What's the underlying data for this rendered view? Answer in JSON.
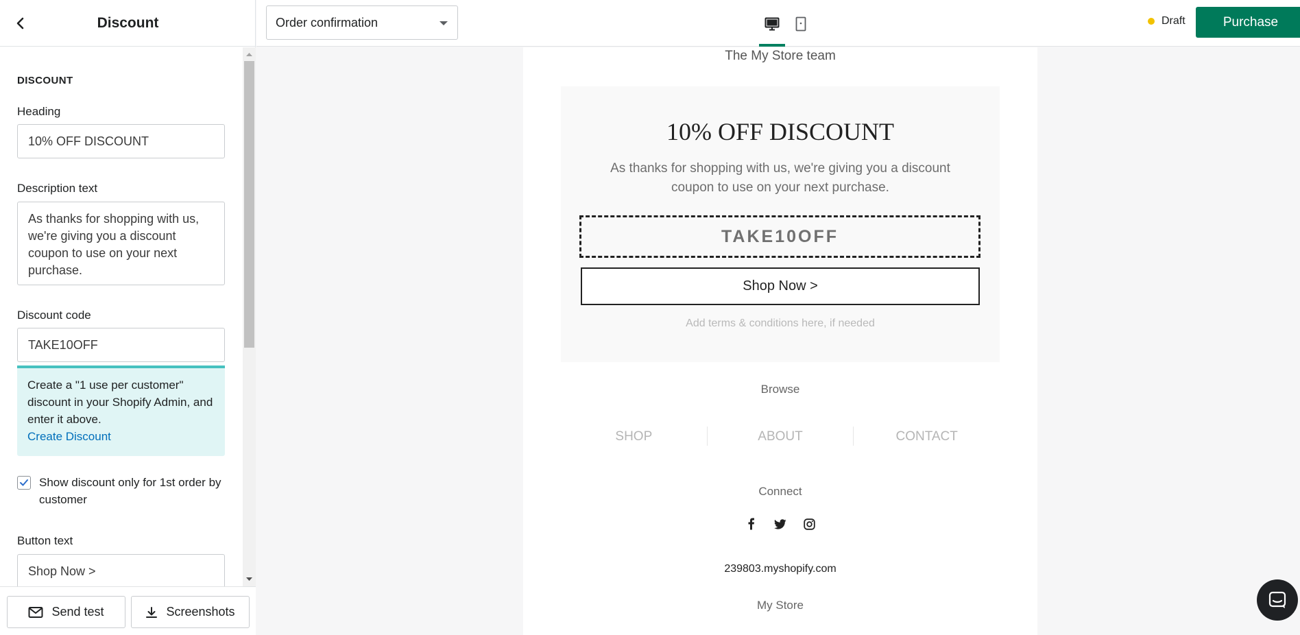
{
  "panel": {
    "title": "Discount",
    "section_title": "DISCOUNT",
    "heading_label": "Heading",
    "heading_value": "10% OFF DISCOUNT",
    "description_label": "Description text",
    "description_value": "As thanks for shopping with us, we're giving you a discount coupon to use on your next purchase.",
    "code_label": "Discount code",
    "code_value": "TAKE10OFF",
    "info_text": "Create a \"1 use per customer\" discount in your Shopify Admin, and enter it above.",
    "info_link": "Create Discount",
    "checkbox_label": "Show discount only for 1st order by customer",
    "checkbox_checked": true,
    "button_text_label": "Button text",
    "button_text_value": "Shop Now >",
    "send_test": "Send test",
    "screenshots": "Screenshots"
  },
  "topbar": {
    "template": "Order confirmation",
    "status": "Draft",
    "purchase": "Purchase",
    "accent_color": "#007a5a",
    "status_color": "#f2c200"
  },
  "email": {
    "team_line": "The My Store team",
    "discount_heading": "10% OFF DISCOUNT",
    "discount_description": "As thanks for shopping with us, we're giving you a discount coupon to use on your next purchase.",
    "discount_code": "TAKE10OFF",
    "button": "Shop Now >",
    "terms": "Add terms & conditions here, if needed",
    "browse": "Browse",
    "nav": [
      "SHOP",
      "ABOUT",
      "CONTACT"
    ],
    "connect": "Connect",
    "social_icons": [
      "facebook-icon",
      "twitter-icon",
      "instagram-icon"
    ],
    "domain": "239803.myshopify.com",
    "store": "My Store"
  }
}
